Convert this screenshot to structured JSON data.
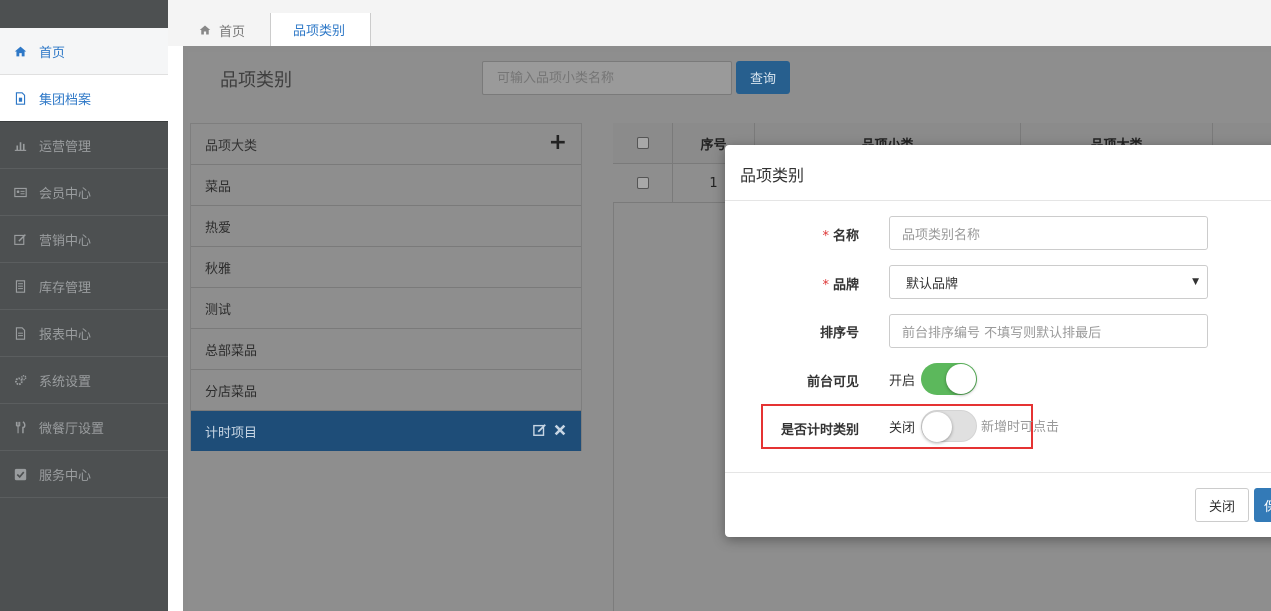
{
  "sidebar": {
    "items": [
      {
        "label": "首页",
        "icon": "home-icon"
      },
      {
        "label": "集团档案",
        "icon": "file-icon"
      },
      {
        "label": "运营管理",
        "icon": "bar-chart-icon"
      },
      {
        "label": "会员中心",
        "icon": "id-card-icon"
      },
      {
        "label": "营销中心",
        "icon": "edit-icon"
      },
      {
        "label": "库存管理",
        "icon": "inventory-icon"
      },
      {
        "label": "报表中心",
        "icon": "report-icon"
      },
      {
        "label": "系统设置",
        "icon": "gears-icon"
      },
      {
        "label": "微餐厅设置",
        "icon": "cutlery-icon"
      },
      {
        "label": "服务中心",
        "icon": "check-square-icon"
      }
    ]
  },
  "tabs": {
    "home": "首页",
    "active": "品项类别"
  },
  "page": {
    "title": "品项类别",
    "search_placeholder": "可输入品项小类名称",
    "search_button": "查询"
  },
  "categories": {
    "header": "品项大类",
    "add": "+",
    "items": [
      "菜品",
      "热爱",
      "秋雅",
      "测试",
      "总部菜品",
      "分店菜品"
    ],
    "selected": "计时项目"
  },
  "table": {
    "columns": [
      "序号",
      "品项小类",
      "品项大类"
    ],
    "rows": [
      {
        "index": "1"
      }
    ]
  },
  "modal": {
    "title": "品项类别",
    "required_mark": "*",
    "name_label": "名称",
    "name_placeholder": "品项类别名称",
    "brand_label": "品牌",
    "brand_value": "默认品牌",
    "sort_label": "排序号",
    "sort_placeholder": "前台排序编号 不填写则默认排最后",
    "visible_label": "前台可见",
    "visible_state": "开启",
    "timed_label": "是否计时类别",
    "timed_state": "关闭",
    "timed_hint": "新增时可点击",
    "close_button": "关闭",
    "save_button": "保"
  },
  "colors": {
    "primary": "#337ab7",
    "switch_on": "#5cb85c",
    "highlight": "#e53333",
    "sidebar_bg": "#4d5051"
  }
}
